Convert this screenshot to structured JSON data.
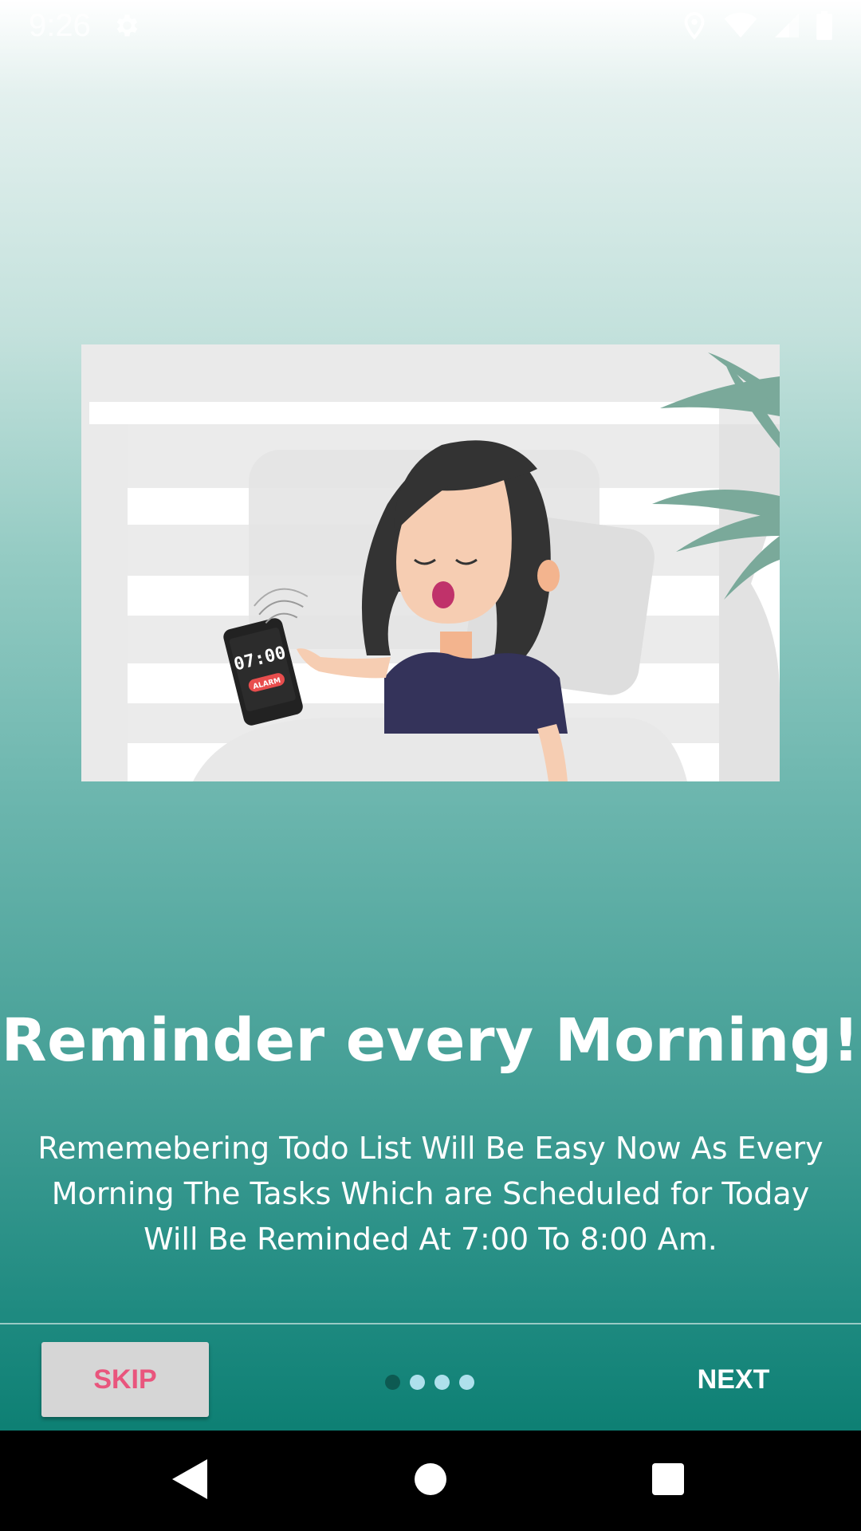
{
  "status_bar": {
    "time": "9:26",
    "icons": [
      "settings-icon",
      "location-icon",
      "wifi-icon",
      "signal-icon",
      "battery-icon"
    ]
  },
  "illustration": {
    "phone_time": "07:00",
    "phone_label": "ALARM"
  },
  "onboarding": {
    "title": "Reminder every Morning!",
    "description": "Rememebering Todo List Will Be Easy Now As Every Morning The Tasks Which are Scheduled for Today Will Be Reminded At 7:00 To 8:00 Am.",
    "page_indicator": {
      "total": 4,
      "current": 1
    }
  },
  "bottom_bar": {
    "skip_label": "SKIP",
    "next_label": "NEXT"
  },
  "nav_bar": {
    "icons": [
      "back-icon",
      "home-icon",
      "recents-icon"
    ]
  },
  "colors": {
    "skip_text": "#e9557d",
    "dot_active": "#0d5a52",
    "dot_inactive": "#aee0ec",
    "bottom_teal": "#0e8074"
  }
}
